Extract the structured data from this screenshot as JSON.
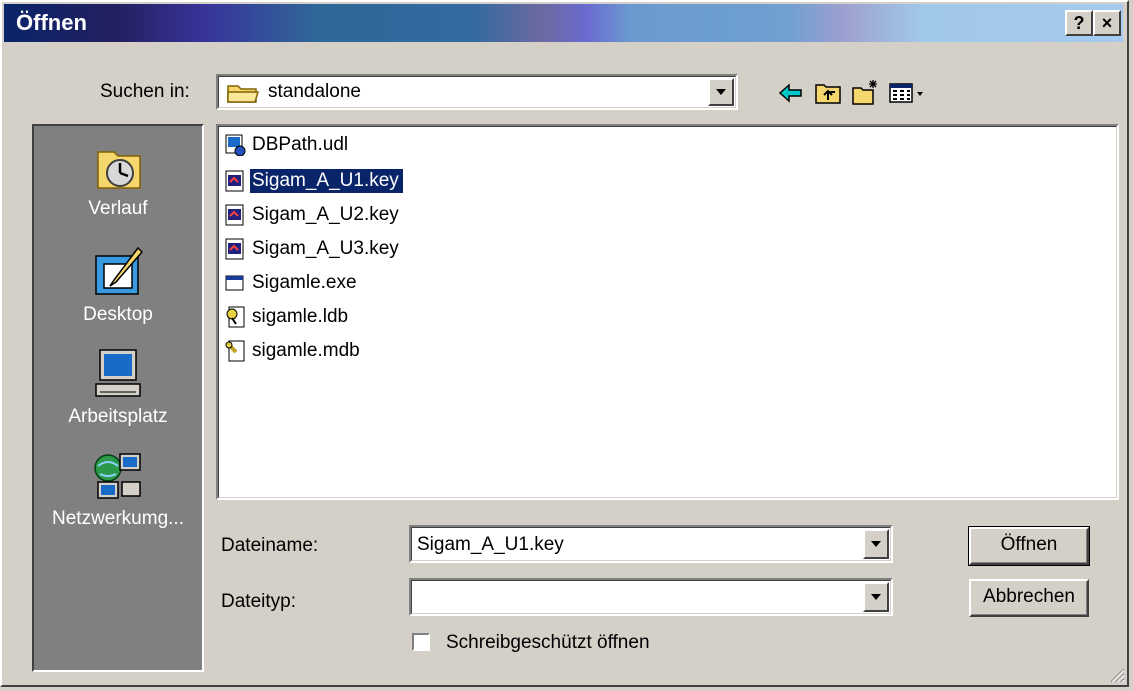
{
  "window": {
    "title": "Öffnen",
    "help_label": "?",
    "close_label": "×"
  },
  "lookin": {
    "label": "Suchen in:",
    "value": "standalone",
    "icon": "folder-icon"
  },
  "toolbar": {
    "icons": [
      "back-arrow-icon",
      "up-folder-icon",
      "new-folder-icon",
      "view-menu-icon"
    ]
  },
  "places": [
    {
      "label": "Verlauf",
      "icon": "history-icon"
    },
    {
      "label": "Desktop",
      "icon": "desktop-icon"
    },
    {
      "label": "Arbeitsplatz",
      "icon": "my-computer-icon"
    },
    {
      "label": "Netzwerkumg...",
      "icon": "network-icon"
    }
  ],
  "files": [
    {
      "name": "DBPath.udl",
      "icon": "udl-file-icon",
      "selected": false
    },
    {
      "name": "Sigam_A_U1.key",
      "icon": "key-file-icon",
      "selected": true
    },
    {
      "name": "Sigam_A_U2.key",
      "icon": "key-file-icon",
      "selected": false
    },
    {
      "name": "Sigam_A_U3.key",
      "icon": "key-file-icon",
      "selected": false
    },
    {
      "name": "Sigamle.exe",
      "icon": "exe-file-icon",
      "selected": false
    },
    {
      "name": "sigamle.ldb",
      "icon": "ldb-file-icon",
      "selected": false
    },
    {
      "name": "sigamle.mdb",
      "icon": "mdb-file-icon",
      "selected": false
    }
  ],
  "filename": {
    "label": "Dateiname:",
    "value": "Sigam_A_U1.key"
  },
  "filetype": {
    "label": "Dateityp:",
    "value": ""
  },
  "readonly": {
    "label": "Schreibgeschützt öffnen",
    "checked": false
  },
  "buttons": {
    "open": "Öffnen",
    "cancel": "Abbrechen"
  },
  "colors": {
    "selection": "#0a246a",
    "face": "#d4d0c8",
    "places_bg": "#808080"
  }
}
